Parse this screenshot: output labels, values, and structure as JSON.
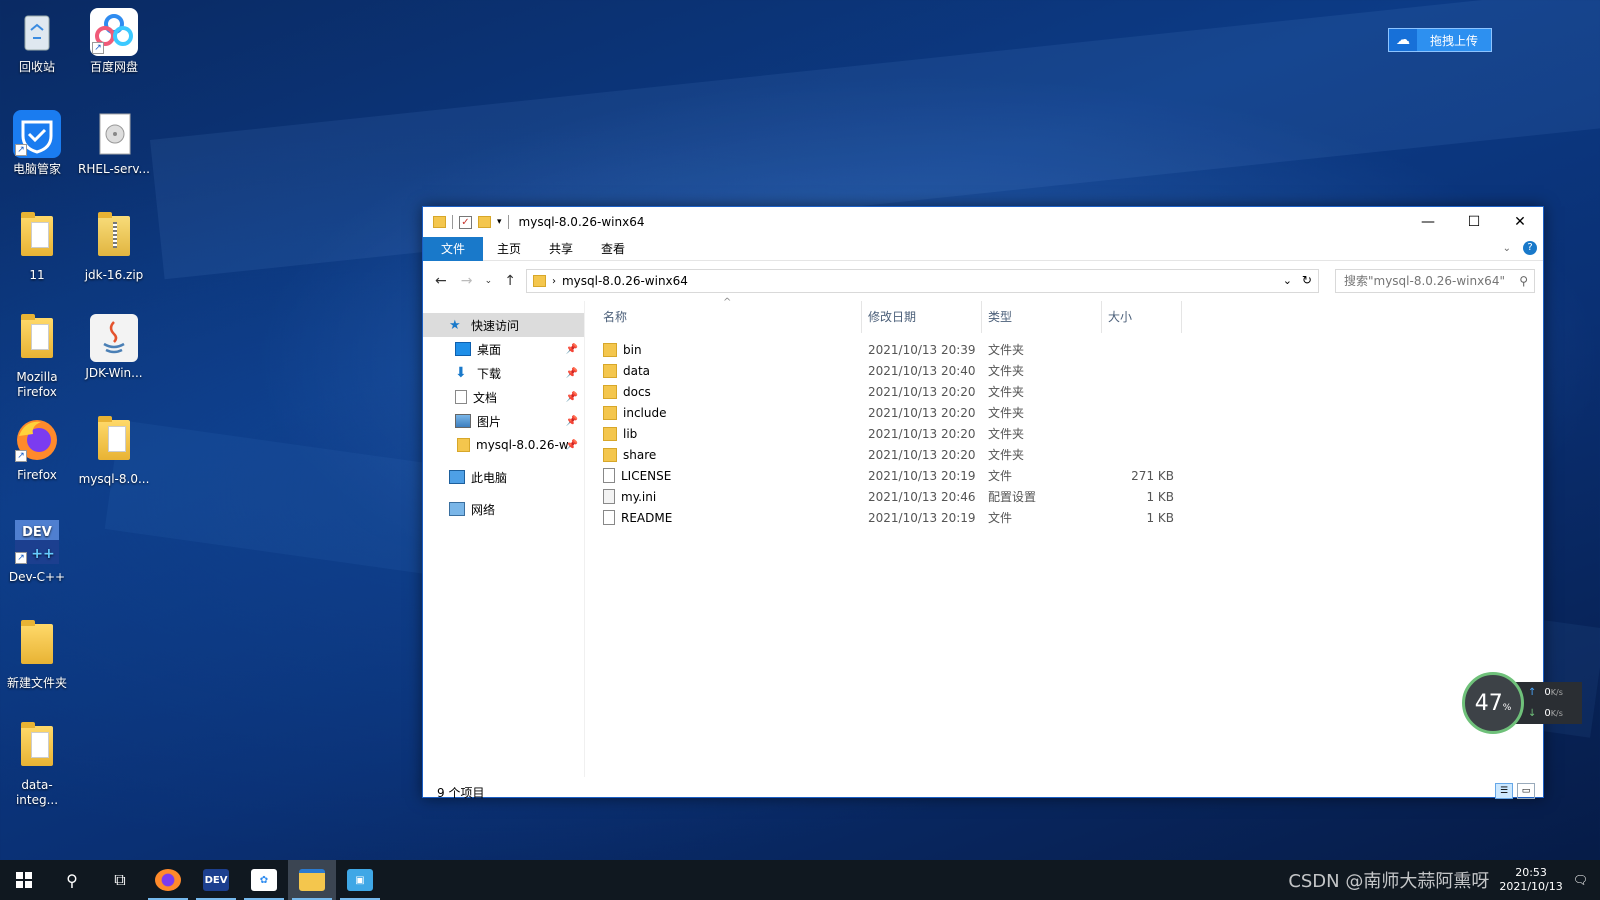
{
  "desktop": {
    "icons": [
      {
        "label": "回收站",
        "icon": "recycle-bin-icon"
      },
      {
        "label": "百度网盘",
        "icon": "baidu-netdisk-icon"
      },
      {
        "label": "电脑管家",
        "icon": "pc-manager-icon"
      },
      {
        "label": "RHEL-serv...",
        "icon": "iso-file-icon"
      },
      {
        "label": "11",
        "icon": "folder-icon"
      },
      {
        "label": "jdk-16.zip",
        "icon": "zip-folder-icon"
      },
      {
        "label": "Mozilla Firefox",
        "icon": "folder-icon"
      },
      {
        "label": "JDK-Win...",
        "icon": "java-icon"
      },
      {
        "label": "Firefox",
        "icon": "firefox-icon"
      },
      {
        "label": "mysql-8.0...",
        "icon": "folder-icon"
      },
      {
        "label": "Dev-C++",
        "icon": "devcpp-icon"
      },
      {
        "label": "新建文件夹",
        "icon": "folder-icon"
      },
      {
        "label": "data-integ...",
        "icon": "folder-icon"
      }
    ],
    "upload_button": "拖拽上传"
  },
  "explorer": {
    "title": "mysql-8.0.26-winx64",
    "ribbon_tabs": [
      "文件",
      "主页",
      "共享",
      "查看"
    ],
    "address": "mysql-8.0.26-winx64",
    "search_placeholder": "搜索\"mysql-8.0.26-winx64\"",
    "nav": {
      "quick_access": "快速访问",
      "pinned": [
        "桌面",
        "下载",
        "文档",
        "图片",
        "mysql-8.0.26-w"
      ],
      "this_pc": "此电脑",
      "network": "网络"
    },
    "columns": {
      "name": "名称",
      "date": "修改日期",
      "type": "类型",
      "size": "大小"
    },
    "files": [
      {
        "name": "bin",
        "date": "2021/10/13 20:39",
        "type": "文件夹",
        "size": "",
        "kind": "folder"
      },
      {
        "name": "data",
        "date": "2021/10/13 20:40",
        "type": "文件夹",
        "size": "",
        "kind": "folder"
      },
      {
        "name": "docs",
        "date": "2021/10/13 20:20",
        "type": "文件夹",
        "size": "",
        "kind": "folder"
      },
      {
        "name": "include",
        "date": "2021/10/13 20:20",
        "type": "文件夹",
        "size": "",
        "kind": "folder"
      },
      {
        "name": "lib",
        "date": "2021/10/13 20:20",
        "type": "文件夹",
        "size": "",
        "kind": "folder"
      },
      {
        "name": "share",
        "date": "2021/10/13 20:20",
        "type": "文件夹",
        "size": "",
        "kind": "folder"
      },
      {
        "name": "LICENSE",
        "date": "2021/10/13 20:19",
        "type": "文件",
        "size": "271 KB",
        "kind": "file"
      },
      {
        "name": "my.ini",
        "date": "2021/10/13 20:46",
        "type": "配置设置",
        "size": "1 KB",
        "kind": "config"
      },
      {
        "name": "README",
        "date": "2021/10/13 20:19",
        "type": "文件",
        "size": "1 KB",
        "kind": "file"
      }
    ],
    "status": "9 个项目"
  },
  "speed_widget": {
    "percent": "47",
    "percent_unit": "%",
    "up": "0",
    "down": "0",
    "unit": "K/s"
  },
  "taskbar": {
    "time": "20:53",
    "date": "2021/10/13",
    "watermark": "CSDN @南师大蒜阿熏呀"
  }
}
